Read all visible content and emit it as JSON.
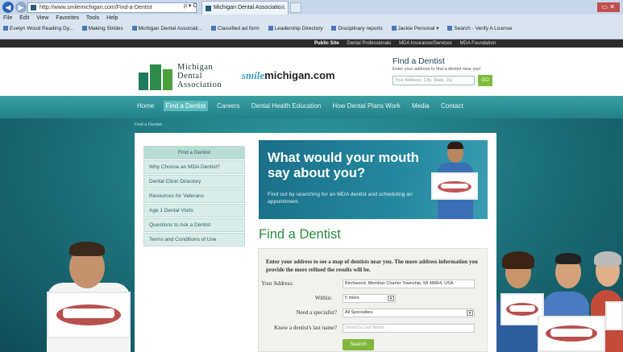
{
  "browser": {
    "address": "http://www.smilemichigan.com/Find-a-Dentist",
    "addr_tools": "ρ ▾ C",
    "tab_title": "Michigan Dental Associatio...",
    "menu": [
      "File",
      "Edit",
      "View",
      "Favorites",
      "Tools",
      "Help"
    ],
    "favorites": [
      "Evelyn Wood Reading Dy...",
      "Making Strides",
      "Michigan Dental Associati...",
      "Classified ad form",
      "Leadership Directory",
      "Disciplinary reports",
      "Jackie Personal ▾",
      "Search - Verify A License"
    ],
    "window_controls": "▭ ✕"
  },
  "util_links": [
    "Public Site",
    "Dental Professionals",
    "MDA Insurance/Services",
    "MDA Foundation"
  ],
  "header": {
    "logo_line1": "Michigan",
    "logo_line2": "Dental",
    "logo_line3": "Association",
    "smile_prefix": "smile",
    "smile_domain": "michigan.com",
    "find_title": "Find a Dentist",
    "find_sub": "Enter your address to find a dentist near you!",
    "find_placeholder": "Your Address, City, State, Zip",
    "go_label": "GO"
  },
  "mainnav": [
    "Home",
    "Find a Dentist",
    "Careers",
    "Dental Health Education",
    "How Dental Plans Work",
    "Media",
    "Contact"
  ],
  "breadcrumb": "Find a Dentist",
  "sidenav": {
    "header": "Find a Dentist",
    "items": [
      "Why Choose an MDA Dentist?",
      "Dental Clinic Directory",
      "Resources for Veterans",
      "Age 1 Dental Visits",
      "Questions to Ask a Dentist",
      "Terms and Conditions of Use"
    ]
  },
  "hero": {
    "title": "What would your mouth say about you?",
    "sub": "Find out by searching for an MDA dentist and scheduling an appointment."
  },
  "page_title": "Find a Dentist",
  "form": {
    "intro": "Enter your address to see a map of dentists near you. The more address information you provide the more refined the results will be.",
    "address_label": "Your Address:",
    "address_value": "Birchwood, Meridian Charter Township, MI 48864, USA",
    "within_label": "Within:",
    "within_value": "5 miles",
    "specialist_label": "Need a specialist?",
    "specialist_value": "All Specialties",
    "lastname_label": "Know a dentist's last name?",
    "lastname_placeholder": "Dentist's Last Name",
    "search_label": "Search"
  },
  "colors": {
    "nav_teal": "#22808a",
    "accent_green": "#7fb83a",
    "title_green": "#2b8a3e"
  }
}
